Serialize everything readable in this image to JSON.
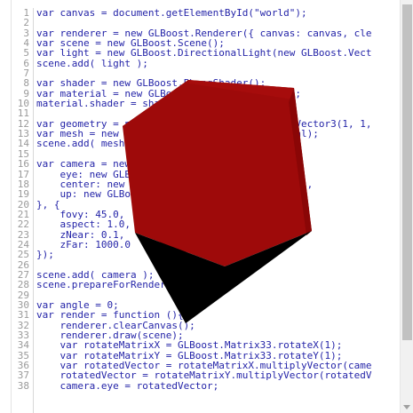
{
  "editor": {
    "lines": [
      {
        "n": "1",
        "t": "var canvas = document.getElementById(\"world\");"
      },
      {
        "n": "2",
        "t": ""
      },
      {
        "n": "3",
        "t": "var renderer = new GLBoost.Renderer({ canvas: canvas, cle"
      },
      {
        "n": "4",
        "t": "var scene = new GLBoost.Scene();"
      },
      {
        "n": "5",
        "t": "var light = new GLBoost.DirectionalLight(new GLBoost.Vect"
      },
      {
        "n": "6",
        "t": "scene.add( light );"
      },
      {
        "n": "7",
        "t": ""
      },
      {
        "n": "8",
        "t": "var shader = new GLBoost.PhongShader();"
      },
      {
        "n": "9",
        "t": "var material = new GLBoost.ClassicMaterial();"
      },
      {
        "n": "10",
        "t": "material.shader = shader;"
      },
      {
        "n": "11",
        "t": ""
      },
      {
        "n": "12",
        "t": "var geometry = new GLBoost.Cube(new GLBoost.Vector3(1, 1,"
      },
      {
        "n": "13",
        "t": "var mesh = new GLBoost.Mesh(geometry, material);"
      },
      {
        "n": "14",
        "t": "scene.add( mesh );"
      },
      {
        "n": "15",
        "t": ""
      },
      {
        "n": "16",
        "t": "var camera = new GLBoost.Camera({"
      },
      {
        "n": "17",
        "t": "    eye: new GLBoost.Vector3(0.0, 0.0, 3),"
      },
      {
        "n": "18",
        "t": "    center: new GLBoost.Vector3(0.0, 0.0, 0.0),"
      },
      {
        "n": "19",
        "t": "    up: new GLBoost.Vector3(0.0, 1.0, 0.0)"
      },
      {
        "n": "20",
        "t": "}, {"
      },
      {
        "n": "21",
        "t": "    fovy: 45.0,"
      },
      {
        "n": "22",
        "t": "    aspect: 1.0,"
      },
      {
        "n": "23",
        "t": "    zNear: 0.1,"
      },
      {
        "n": "24",
        "t": "    zFar: 1000.0"
      },
      {
        "n": "25",
        "t": "});"
      },
      {
        "n": "26",
        "t": ""
      },
      {
        "n": "27",
        "t": "scene.add( camera );"
      },
      {
        "n": "28",
        "t": "scene.prepareForRender();"
      },
      {
        "n": "29",
        "t": ""
      },
      {
        "n": "30",
        "t": "var angle = 0;"
      },
      {
        "n": "31",
        "t": "var render = function (){"
      },
      {
        "n": "32",
        "t": "    renderer.clearCanvas();"
      },
      {
        "n": "33",
        "t": "    renderer.draw(scene);"
      },
      {
        "n": "34",
        "t": "    var rotateMatrixX = GLBoost.Matrix33.rotateX(1);"
      },
      {
        "n": "35",
        "t": "    var rotateMatrixY = GLBoost.Matrix33.rotateY(1);"
      },
      {
        "n": "36",
        "t": "    var rotatedVector = rotateMatrixX.multiplyVector(came"
      },
      {
        "n": "37",
        "t": "    rotatedVector = rotateMatrixY.multiplyVector(rotatedV"
      },
      {
        "n": "38",
        "t": "    camera.eye = rotatedVector;"
      }
    ]
  },
  "colors": {
    "cube_red": "#9b0808",
    "cube_red_dark": "#8a0606",
    "cube_black": "#000000"
  }
}
